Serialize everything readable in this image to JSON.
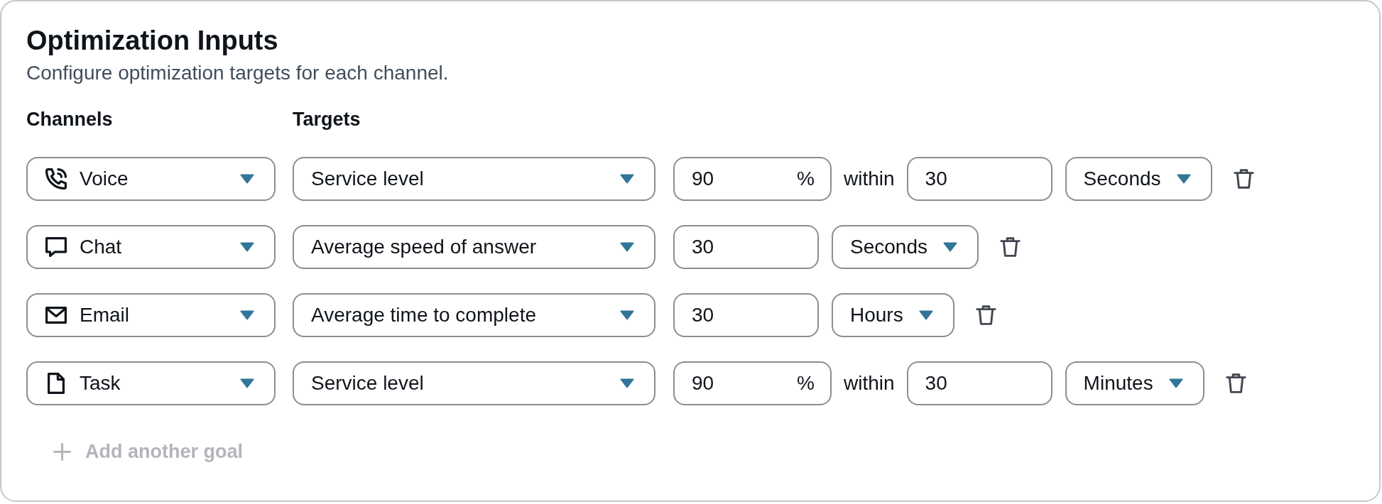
{
  "header": {
    "title": "Optimization Inputs",
    "description": "Configure optimization targets for each channel."
  },
  "columns": [
    "Channels",
    "Targets"
  ],
  "goals": [
    {
      "kind": "percentage",
      "channel": {
        "kind": "voice",
        "label": "Voice"
      },
      "target": "Service level",
      "percent": "90",
      "percent_sign": "%",
      "connector": "within",
      "value": "30",
      "unit": "Seconds"
    },
    {
      "kind": "value",
      "channel": {
        "kind": "chat",
        "label": "Chat"
      },
      "target": "Average speed of answer",
      "value": "30",
      "unit": "Seconds"
    },
    {
      "kind": "value",
      "channel": {
        "kind": "email",
        "label": "Email"
      },
      "target": "Average time to complete",
      "value": "30",
      "unit": "Hours"
    },
    {
      "kind": "percentage",
      "channel": {
        "kind": "task",
        "label": "Task"
      },
      "target": "Service level",
      "percent": "90",
      "percent_sign": "%",
      "connector": "within",
      "value": "30",
      "unit": "Minutes"
    }
  ],
  "add_button": {
    "label": "Add another goal",
    "disabled": true
  }
}
